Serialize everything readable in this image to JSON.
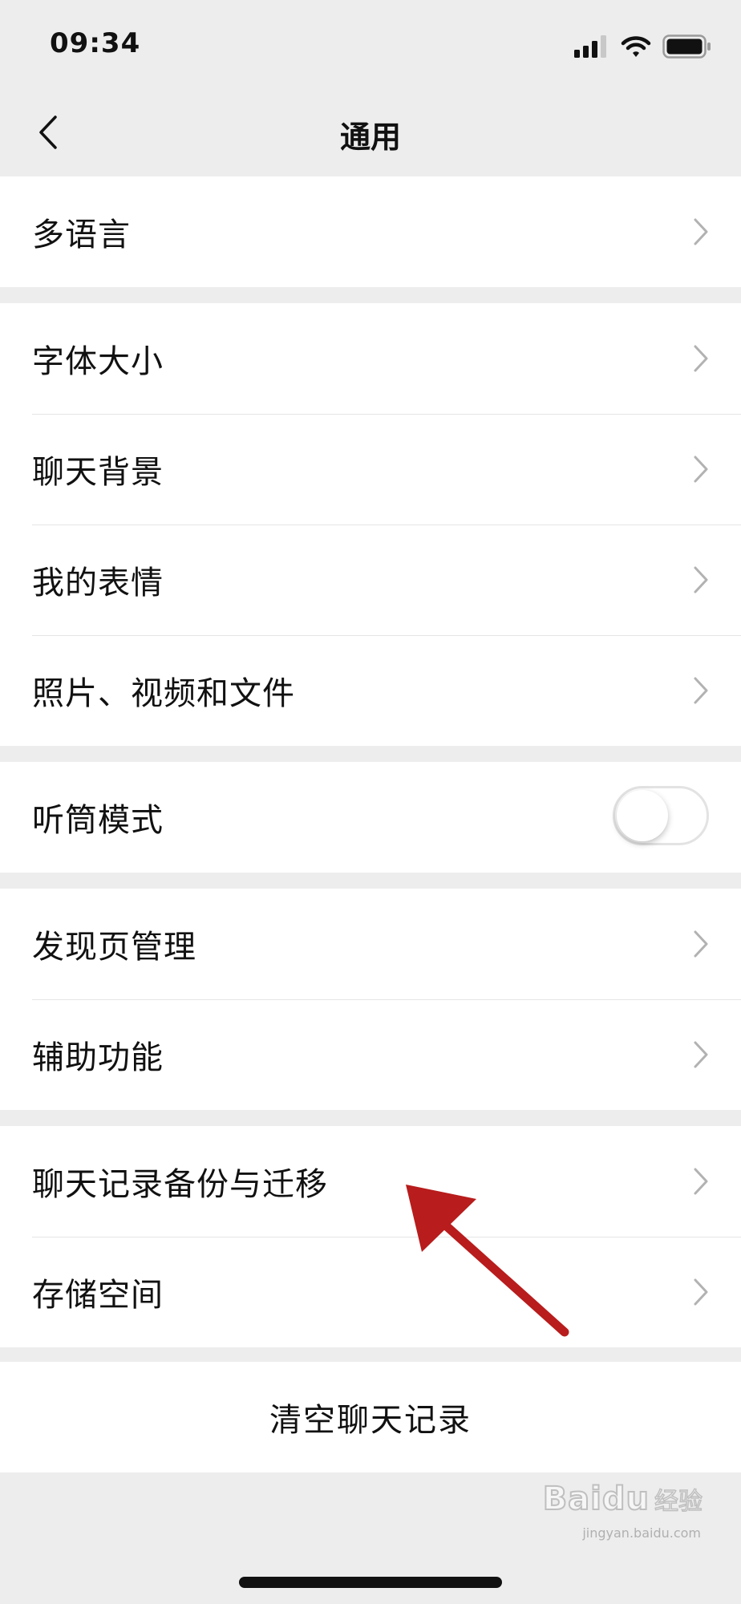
{
  "status_bar": {
    "time": "09:34",
    "icons": [
      "signal-icon",
      "wifi-icon",
      "battery-icon"
    ]
  },
  "nav": {
    "back_icon": "chevron-left-icon",
    "title": "通用"
  },
  "groups": {
    "language": {
      "label": "多语言"
    },
    "display": {
      "items": [
        "字体大小",
        "聊天背景",
        "我的表情",
        "照片、视频和文件"
      ]
    },
    "earpiece": {
      "label": "听筒模式",
      "toggle_on": false
    },
    "discover": {
      "items": [
        "发现页管理",
        "辅助功能"
      ]
    },
    "storage": {
      "items": [
        "聊天记录备份与迁移",
        "存储空间"
      ]
    },
    "clear": {
      "label": "清空聊天记录"
    }
  },
  "annotation": {
    "color": "#b81c1c"
  },
  "watermark": {
    "logo": "Baidu",
    "text": "经验",
    "url": "jingyan.baidu.com"
  },
  "colors": {
    "background": "#ededed",
    "row": "#ffffff",
    "chevron": "#b2b2b2",
    "toggle_off": "#e3e3e3"
  }
}
